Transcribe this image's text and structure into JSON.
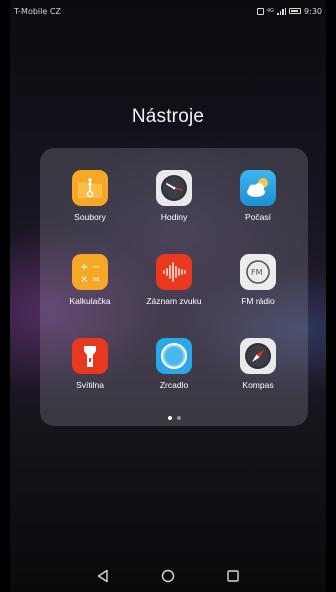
{
  "status_bar": {
    "carrier": "T-Mobile CZ",
    "network": "4G",
    "time": "9:30"
  },
  "folder": {
    "title": "Nástroje",
    "apps": [
      {
        "label": "Soubory",
        "icon": "folder-icon",
        "color": "#f4a825"
      },
      {
        "label": "Hodiny",
        "icon": "clock-icon",
        "color": "#e8e8e8"
      },
      {
        "label": "Počasí",
        "icon": "weather-icon",
        "color": "#2aa8e8"
      },
      {
        "label": "Kalkulačka",
        "icon": "calculator-icon",
        "color": "#f4a825"
      },
      {
        "label": "Záznam zvuku",
        "icon": "sound-recorder-icon",
        "color": "#e8391e"
      },
      {
        "label": "FM rádio",
        "icon": "fm-radio-icon",
        "color": "#e8e8e8"
      },
      {
        "label": "Svítilna",
        "icon": "flashlight-icon",
        "color": "#e8391e"
      },
      {
        "label": "Zrcadlo",
        "icon": "mirror-icon",
        "color": "#2aa8e8"
      },
      {
        "label": "Kompas",
        "icon": "compass-icon",
        "color": "#e8e8e8"
      }
    ],
    "page_count": 2,
    "current_page": 1
  },
  "nav_bar": {
    "back": "back-icon",
    "home": "home-icon",
    "recents": "recents-icon"
  }
}
